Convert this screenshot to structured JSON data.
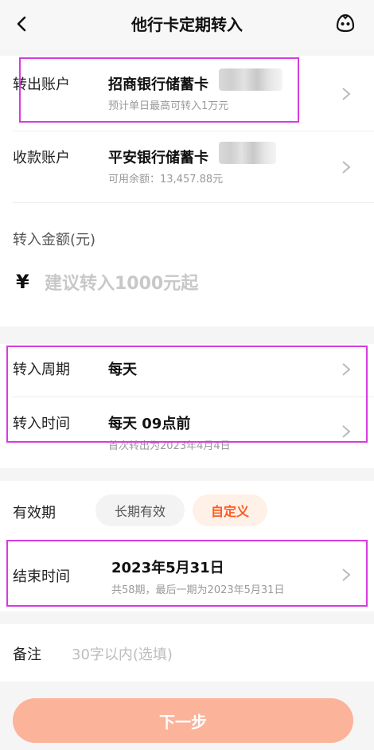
{
  "header": {
    "title": "他行卡定期转入"
  },
  "from_account": {
    "label": "转出账户",
    "bank": "招商银行储蓄卡",
    "hint": "预计单日最高可转入1万元"
  },
  "to_account": {
    "label": "收款账户",
    "bank": "平安银行储蓄卡",
    "balance": "可用余额：13,457.88元"
  },
  "amount": {
    "label": "转入金额(元)",
    "currency": "¥",
    "placeholder": "建议转入1000元起"
  },
  "schedule": {
    "period_label": "转入周期",
    "period_value": "每天",
    "time_label": "转入时间",
    "time_value": "每天 09点前",
    "time_hint": "首次转出为2023年4月4日"
  },
  "validity": {
    "label": "有效期",
    "options": [
      {
        "label": "长期有效",
        "selected": false
      },
      {
        "label": "自定义",
        "selected": true
      }
    ]
  },
  "end_time": {
    "label": "结束时间",
    "value": "2023年5月31日",
    "hint": "共58期，最后一期为2023年5月31日"
  },
  "remark": {
    "label": "备注",
    "placeholder": "30字以内(选填)"
  },
  "next_button": {
    "label": "下一步"
  },
  "colors": {
    "accent": "#ff5a1f",
    "button": "#fbb39a",
    "highlight": "#d63be0"
  }
}
